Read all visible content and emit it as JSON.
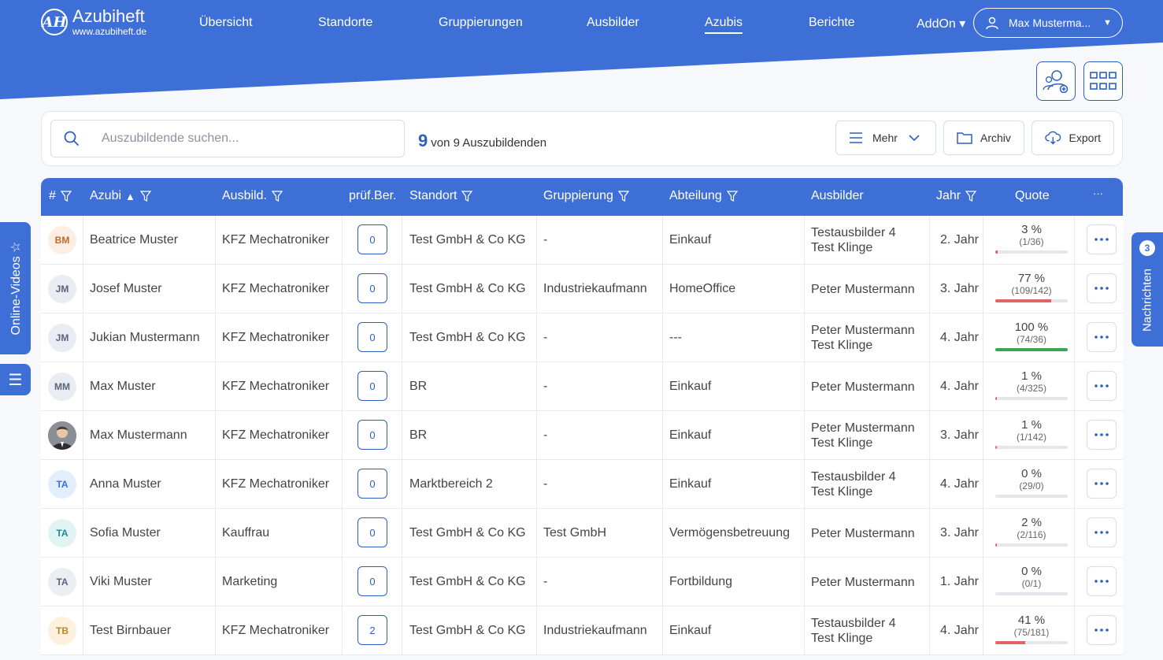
{
  "brand": {
    "name": "Azubiheft",
    "url": "www.azubiheft.de",
    "mark": "AH"
  },
  "nav": {
    "items": [
      "Übersicht",
      "Standorte",
      "Gruppierungen",
      "Ausbilder",
      "Azubis",
      "Berichte",
      "AddOn ▾"
    ],
    "active": "Azubis",
    "user": "Max Musterma..."
  },
  "toolbar": {
    "search_placeholder": "Auszubildende suchen...",
    "count_number": "9",
    "count_text": "von 9 Auszubildenden",
    "mehr": "Mehr",
    "archiv": "Archiv",
    "export": "Export"
  },
  "table": {
    "headers": {
      "num": "#",
      "azubi": "Azubi",
      "ausbild": "Ausbild.",
      "pruef": "prüf.Ber.",
      "standort": "Standort",
      "gruppierung": "Gruppierung",
      "abteilung": "Abteilung",
      "ausbilder": "Ausbilder",
      "jahr": "Jahr",
      "quote": "Quote",
      "more": "···"
    },
    "rows": [
      {
        "initials": "BM",
        "name": "Beatrice Muster",
        "ausbildung": "KFZ Mechatroniker",
        "pruef": "0",
        "standort": "Test GmbH & Co KG",
        "gruppierung": "-",
        "abteilung": "Einkauf",
        "ausbilder1": "Testausbilder 4",
        "ausbilder2": "Test Klinge",
        "jahr": "2. Jahr",
        "quote_pct": "3 %",
        "quote_frac": "(1/36)",
        "quote_value": 3
      },
      {
        "initials": "JM",
        "name": "Josef Muster",
        "ausbildung": "KFZ Mechatroniker",
        "pruef": "0",
        "standort": "Test GmbH & Co KG",
        "gruppierung": "Industriekaufmann",
        "abteilung": "HomeOffice",
        "ausbilder1": "Peter Mustermann",
        "ausbilder2": "",
        "jahr": "3. Jahr",
        "quote_pct": "77 %",
        "quote_frac": "(109/142)",
        "quote_value": 77
      },
      {
        "initials": "JM",
        "name": "Jukian Mustermann",
        "ausbildung": "KFZ Mechatroniker",
        "pruef": "0",
        "standort": "Test GmbH & Co KG",
        "gruppierung": "-",
        "abteilung": "---",
        "ausbilder1": "Peter Mustermann",
        "ausbilder2": "Test Klinge",
        "jahr": "4. Jahr",
        "quote_pct": "100 %",
        "quote_frac": "(74/36)",
        "quote_value": 100
      },
      {
        "initials": "MM",
        "name": "Max Muster",
        "ausbildung": "KFZ Mechatroniker",
        "pruef": "0",
        "standort": "BR",
        "gruppierung": "-",
        "abteilung": "Einkauf",
        "ausbilder1": "Peter Mustermann",
        "ausbilder2": "",
        "jahr": "4. Jahr",
        "quote_pct": "1 %",
        "quote_frac": "(4/325)",
        "quote_value": 1
      },
      {
        "initials": "",
        "photo": true,
        "name": "Max Mustermann",
        "ausbildung": "KFZ Mechatroniker",
        "pruef": "0",
        "standort": "BR",
        "gruppierung": "-",
        "abteilung": "Einkauf",
        "ausbilder1": "Peter Mustermann",
        "ausbilder2": "Test Klinge",
        "jahr": "3. Jahr",
        "quote_pct": "1 %",
        "quote_frac": "(1/142)",
        "quote_value": 1
      },
      {
        "initials": "TA",
        "name": "Anna Muster",
        "ausbildung": "KFZ Mechatroniker",
        "pruef": "0",
        "standort": "Marktbereich 2",
        "gruppierung": "-",
        "abteilung": "Einkauf",
        "ausbilder1": "Testausbilder 4",
        "ausbilder2": "Test Klinge",
        "jahr": "4. Jahr",
        "quote_pct": "0 %",
        "quote_frac": "(29/0)",
        "quote_value": 0
      },
      {
        "initials": "TA",
        "name": "Sofia Muster",
        "ausbildung": "Kauffrau",
        "pruef": "0",
        "standort": "Test GmbH & Co KG",
        "gruppierung": "Test GmbH",
        "abteilung": "Vermögensbetreuung",
        "ausbilder1": "Peter Mustermann",
        "ausbilder2": "",
        "jahr": "3. Jahr",
        "quote_pct": "2 %",
        "quote_frac": "(2/116)",
        "quote_value": 2
      },
      {
        "initials": "TA",
        "name": "Viki Muster",
        "ausbildung": "Marketing",
        "pruef": "0",
        "standort": "Test GmbH & Co KG",
        "gruppierung": "-",
        "abteilung": "Fortbildung",
        "ausbilder1": "Peter Mustermann",
        "ausbilder2": "",
        "jahr": "1. Jahr",
        "quote_pct": "0 %",
        "quote_frac": "(0/1)",
        "quote_value": 0
      },
      {
        "initials": "TB",
        "name": "Test Birnbauer",
        "ausbildung": "KFZ Mechatroniker",
        "pruef": "2",
        "standort": "Test GmbH & Co KG",
        "gruppierung": "Industriekaufmann",
        "abteilung": "Einkauf",
        "ausbilder1": "Testausbilder 4",
        "ausbilder2": "Test Klinge",
        "jahr": "4. Jahr",
        "quote_pct": "41 %",
        "quote_frac": "(75/181)",
        "quote_value": 41
      }
    ]
  },
  "side": {
    "videos": "Online-Videos ☆",
    "menu": "☰",
    "messages": "Nachrichten",
    "messages_count": "3"
  },
  "colors": {
    "primary": "#3e6fd6",
    "danger": "#e06464",
    "success": "#3aa457"
  }
}
